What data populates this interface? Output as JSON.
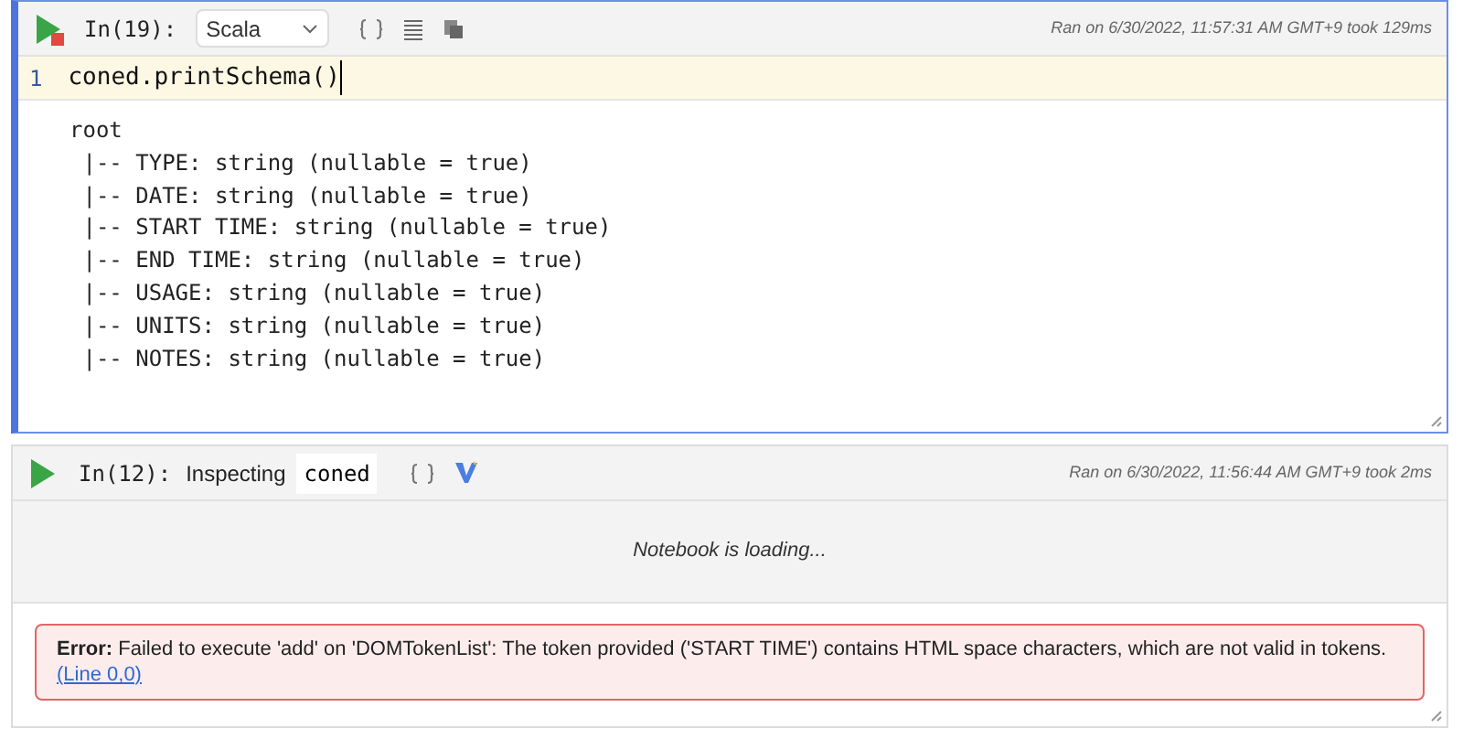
{
  "cells": [
    {
      "kind": "code",
      "selected": true,
      "prompt": "In(19):",
      "language": "Scala",
      "ran": "Ran on 6/30/2022, 11:57:31 AM GMT+9 took 129ms",
      "code_line_number": "1",
      "code": "coned.printSchema()",
      "output": [
        "root",
        " |-- TYPE: string (nullable = true)",
        " |-- DATE: string (nullable = true)",
        " |-- START TIME: string (nullable = true)",
        " |-- END TIME: string (nullable = true)",
        " |-- USAGE: string (nullable = true)",
        " |-- UNITS: string (nullable = true)",
        " |-- NOTES: string (nullable = true)"
      ]
    },
    {
      "kind": "inspect",
      "selected": false,
      "prompt": "In(12):",
      "label": "Inspecting",
      "variable": "coned",
      "ran": "Ran on 6/30/2022, 11:56:44 AM GMT+9 took 2ms",
      "loading": "Notebook is loading...",
      "error": "**Error:** Failed to execute 'add' on 'DOMTokenList': The token provided ('START TIME') contains HTML space characters, which are not valid in tokens.",
      "error_link": "(Line 0,0)"
    }
  ]
}
